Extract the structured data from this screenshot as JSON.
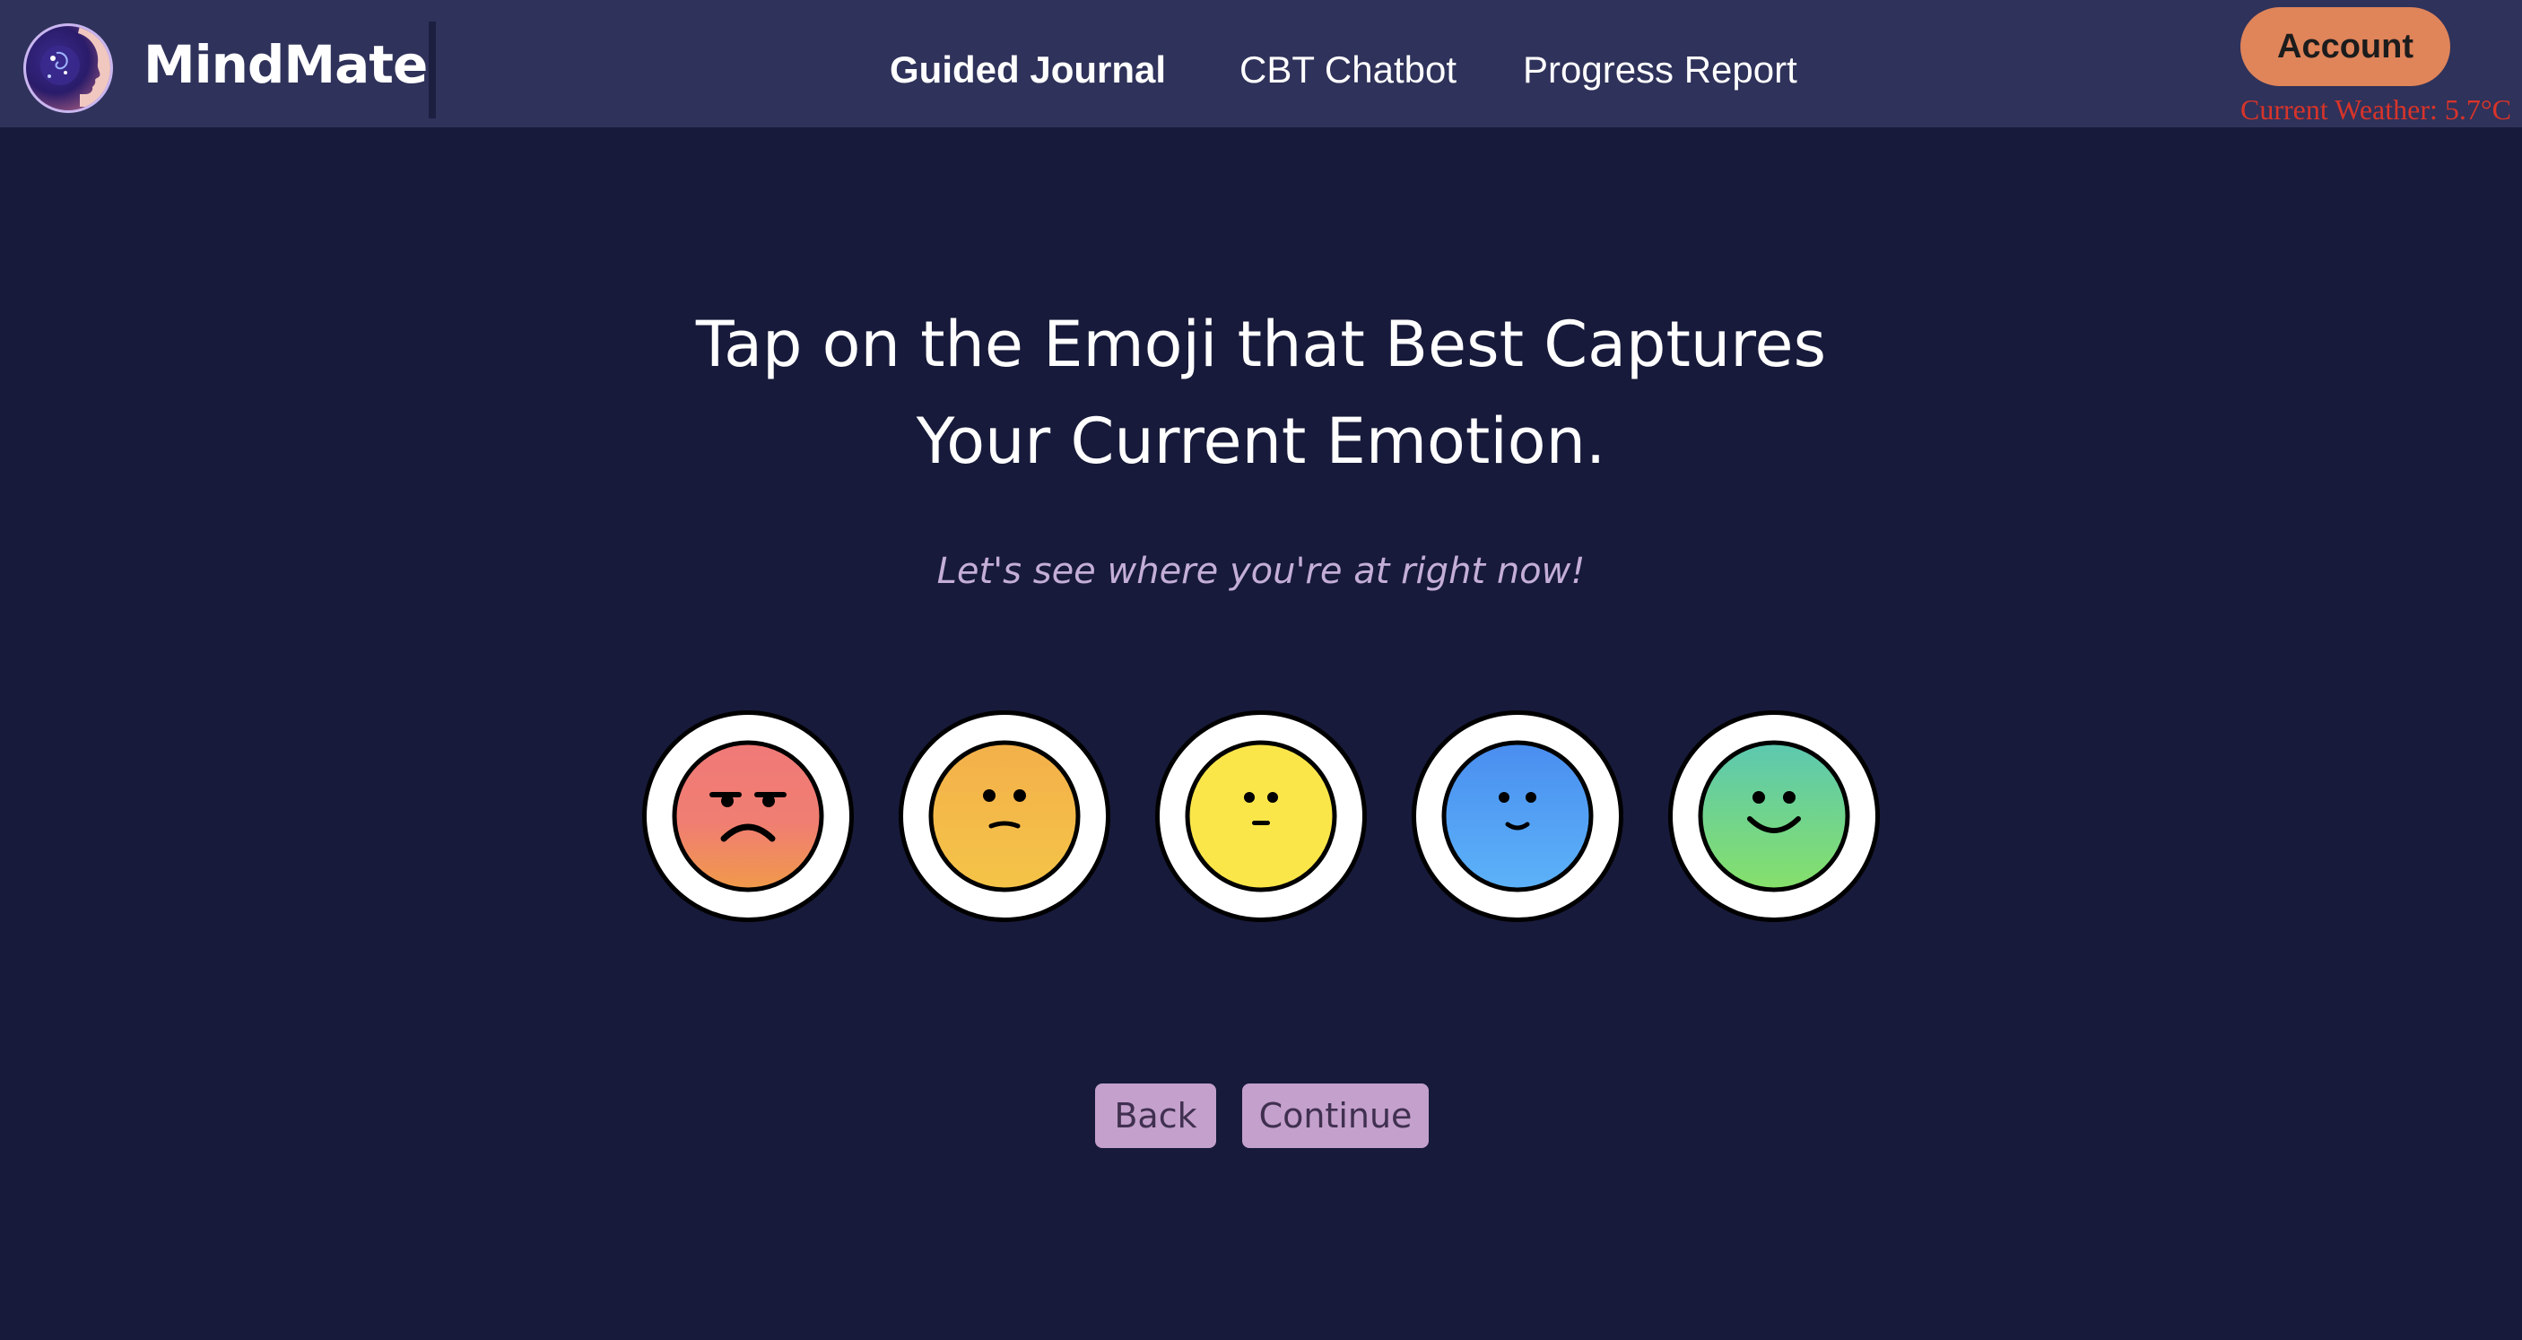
{
  "app": {
    "name": "MindMate",
    "logo_icon": "woman-profile-galaxy-icon"
  },
  "nav": {
    "items": [
      {
        "label": "Guided Journal",
        "active": true
      },
      {
        "label": "CBT Chatbot",
        "active": false
      },
      {
        "label": "Progress Report",
        "active": false
      }
    ],
    "account_label": "Account",
    "weather_text": "Current Weather: 5.7°C"
  },
  "main": {
    "headline_line1": "Tap on the Emoji that Best Captures",
    "headline_line2": "Your Current Emotion.",
    "subtitle": "Let's see where you're at right now!"
  },
  "emojis": [
    {
      "icon": "angry-face-icon",
      "colors": [
        "#f07a78",
        "#f09a4a"
      ]
    },
    {
      "icon": "sad-face-icon",
      "colors": [
        "#f3b04a",
        "#f5c448"
      ]
    },
    {
      "icon": "neutral-face-icon",
      "colors": [
        "#fbe64a",
        "#fbe64a"
      ]
    },
    {
      "icon": "slightly-smiling-face-icon",
      "colors": [
        "#4a8ef0",
        "#5cb2f8"
      ]
    },
    {
      "icon": "happy-face-icon",
      "colors": [
        "#5cc8b0",
        "#86e06a"
      ]
    }
  ],
  "buttons": {
    "back_label": "Back",
    "continue_label": "Continue"
  },
  "colors": {
    "background": "#171a3a",
    "navbar": "#2f325a",
    "account": "#e0845a",
    "weather": "#d8342a",
    "button": "#c4a0cc",
    "subtitle": "#c4aed8"
  }
}
